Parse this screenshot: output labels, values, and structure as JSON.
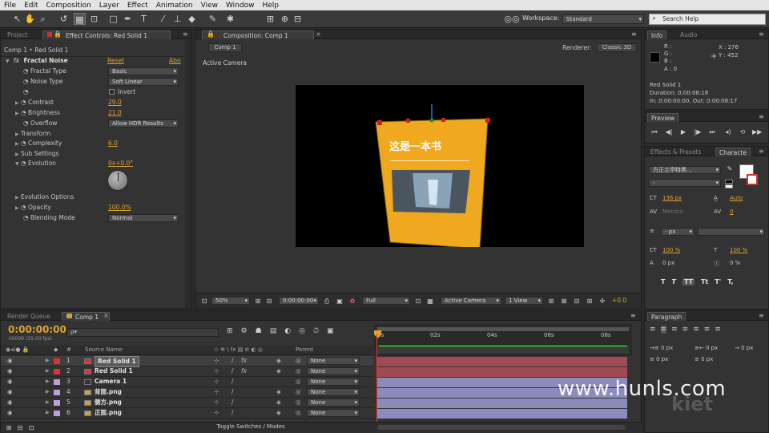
{
  "menu": [
    "File",
    "Edit",
    "Composition",
    "Layer",
    "Effect",
    "Animation",
    "View",
    "Window",
    "Help"
  ],
  "toolbar": {
    "workspace_label": "Workspace:",
    "workspace_value": "Standard",
    "search_placeholder": "Search Help"
  },
  "left_panel": {
    "tabs": [
      "Project",
      "Effect Controls: Red Solid 1"
    ],
    "breadcrumb": "Comp 1 • Red Solid 1",
    "effect": {
      "name": "Fractal Noise",
      "reset": "Reset",
      "about": "Abo",
      "rows": [
        {
          "label": "Fractal Type",
          "dropdown": "Basic"
        },
        {
          "label": "Noise Type",
          "dropdown": "Soft Linear"
        },
        {
          "label": "",
          "checkbox": "Invert"
        },
        {
          "label": "Contrast",
          "value": "29.0"
        },
        {
          "label": "Brightness",
          "value": "21.0"
        },
        {
          "label": "Overflow",
          "dropdown": "Allow HDR Results"
        },
        {
          "label": "Transform"
        },
        {
          "label": "Complexity",
          "value": "6.0"
        },
        {
          "label": "Sub Settings"
        },
        {
          "label": "Evolution",
          "value": "0x+0.0°"
        },
        {
          "label": "Evolution Options"
        },
        {
          "label": "Opacity",
          "value": "100.0%"
        },
        {
          "label": "Blending Mode",
          "dropdown": "Normal"
        }
      ]
    }
  },
  "comp_panel": {
    "tab": "Composition: Comp 1",
    "comp_tab": "Comp 1",
    "renderer_label": "Renderer:",
    "renderer_value": "Classic 3D",
    "view_label": "Active Camera",
    "book_title": "这是一本书",
    "footer": {
      "zoom": "50%",
      "timecode": "0:00:00:00",
      "resolution": "Full",
      "camera": "Active Camera",
      "views": "1 View",
      "exposure": "+0.0"
    }
  },
  "info": {
    "tabs": [
      "Info",
      "Audio"
    ],
    "r": "R :",
    "g": "G :",
    "b": "B :",
    "a": "A : 0",
    "x": "X : 276",
    "y": "Y : 452",
    "layer": "Red Solid 1",
    "duration": "Duration: 0:00:08:18",
    "inout": "In: 0:00:00:00, Out: 0:00:08:17"
  },
  "preview": {
    "tab": "Preview"
  },
  "character": {
    "tabs": [
      "Effects & Presets",
      "Characte"
    ],
    "font": "方正兰亭特黑...",
    "font_size": "136 px",
    "leading": "Auto",
    "kerning": "Metrics",
    "tracking": "0",
    "stroke": "- px",
    "v_scale": "100 %",
    "h_scale": "100 %",
    "baseline": "0 px",
    "tsume": "0 %",
    "styles": [
      "T",
      "T",
      "TT",
      "Tt",
      "T'",
      "T,"
    ]
  },
  "paragraph": {
    "tab": "Paragraph",
    "indent": [
      "0 px",
      "0 px",
      "0 px",
      "0 px",
      "0 px"
    ]
  },
  "timeline": {
    "tabs": [
      "Render Queue",
      "Comp 1"
    ],
    "timecode": "0:00:00:00",
    "fps": "00000 (25.00 fps)",
    "search_placeholder": "ρ▾",
    "headers": {
      "source": "Source Name",
      "parent": "Parent"
    },
    "ruler": [
      "0s",
      "02s",
      "04s",
      "06s",
      "08s"
    ],
    "layers": [
      {
        "num": "1",
        "name": "Red Solid 1",
        "color": "#d33",
        "type": "solid",
        "parent": "None"
      },
      {
        "num": "2",
        "name": "Red Solid 1",
        "color": "#d33",
        "type": "solid",
        "parent": "None"
      },
      {
        "num": "3",
        "name": "Camera 1",
        "color": "#b9a2d8",
        "type": "camera",
        "parent": "None"
      },
      {
        "num": "4",
        "name": "背面.png",
        "color": "#b9a2d8",
        "type": "image",
        "parent": "None"
      },
      {
        "num": "5",
        "name": "侧方.png",
        "color": "#b9a2d8",
        "type": "image",
        "parent": "None"
      },
      {
        "num": "6",
        "name": "正面.png",
        "color": "#b9a2d8",
        "type": "image",
        "parent": "None"
      }
    ],
    "toggle_label": "Toggle Switches / Modes"
  },
  "watermark": "www.hunls.com",
  "colors": {
    "accent": "#dba431",
    "panel": "#333333",
    "red_bar": "#a04a53",
    "purple_bar": "#8c8cbc"
  }
}
